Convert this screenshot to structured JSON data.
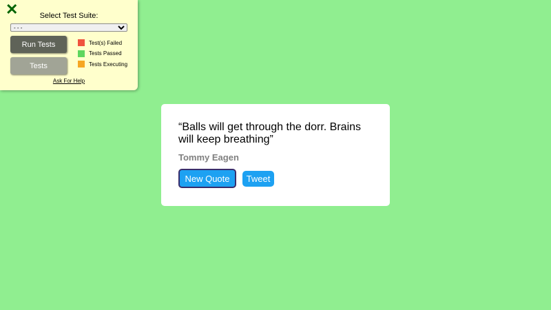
{
  "test_panel": {
    "close_glyph": "✕",
    "title": "Select Test Suite:",
    "select_value": "- - -",
    "run_button_label": "Run Tests",
    "tests_button_label": "Tests",
    "legend": [
      {
        "label": "Test(s) Failed",
        "color": "#f0533e"
      },
      {
        "label": "Tests Passed",
        "color": "#5ed65e"
      },
      {
        "label": "Tests Executing",
        "color": "#f5a623"
      }
    ],
    "help_link": "Ask For Help"
  },
  "quote_box": {
    "text": "“Balls will get through the dorr. Brains will keep breathing”",
    "author": "Tommy Eagen",
    "new_quote_label": "New Quote",
    "tweet_label": "Tweet"
  },
  "colors": {
    "page_background": "#90ee90",
    "panel_background": "#ffffcc",
    "button_blue": "#1da1f2"
  }
}
